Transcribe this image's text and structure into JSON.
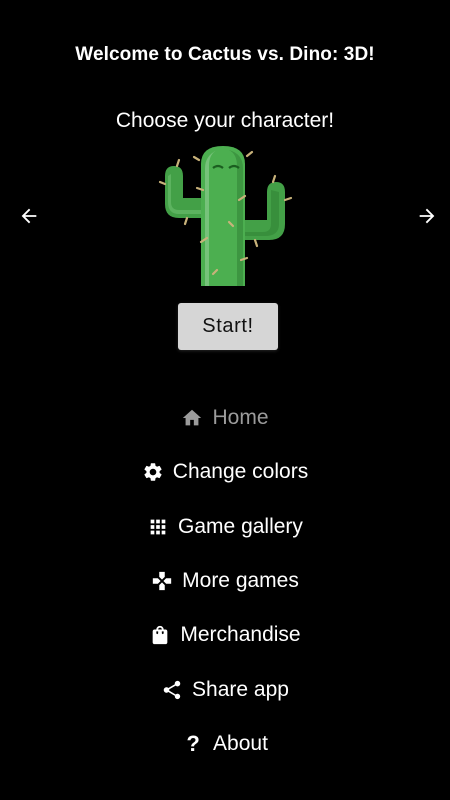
{
  "header": {
    "title": "Welcome to Cactus vs. Dino: 3D!",
    "subtitle": "Choose your character!"
  },
  "carousel": {
    "prev_icon": "arrow-left-icon",
    "next_icon": "arrow-right-icon",
    "character": "cactus"
  },
  "start_button": {
    "label": "Start!"
  },
  "menu": {
    "items": [
      {
        "label": "Home",
        "icon": "home-icon",
        "active": true
      },
      {
        "label": "Change colors",
        "icon": "gear-icon",
        "active": false
      },
      {
        "label": "Game gallery",
        "icon": "grid-icon",
        "active": false
      },
      {
        "label": "More games",
        "icon": "gamepad-icon",
        "active": false
      },
      {
        "label": "Merchandise",
        "icon": "shopping-bag-icon",
        "active": false
      },
      {
        "label": "Share app",
        "icon": "share-icon",
        "active": false
      },
      {
        "label": "About",
        "icon": "question-icon",
        "active": false
      }
    ]
  },
  "colors": {
    "background": "#000000",
    "text": "#ffffff",
    "active_text": "#9b9b9b",
    "button_bg": "#d6d6d6",
    "cactus_green": "#4caf50"
  }
}
